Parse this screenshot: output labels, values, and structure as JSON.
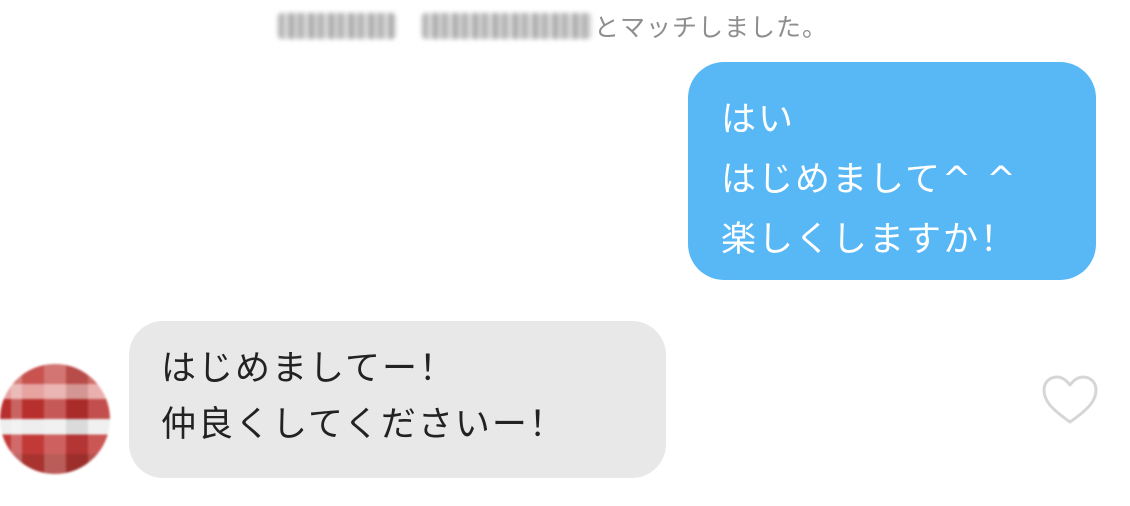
{
  "match_notice": {
    "text": "とマッチしました。"
  },
  "outgoing_message": {
    "lines": [
      "はい",
      "はじめまして^ ^",
      "楽しくしますか！"
    ],
    "color": "#58b8f6"
  },
  "incoming_message": {
    "lines": [
      "はじめましてー！",
      "仲良くしてくださいー！"
    ],
    "color": "#e8e8e8"
  },
  "like_icon": "heart-outline-icon"
}
